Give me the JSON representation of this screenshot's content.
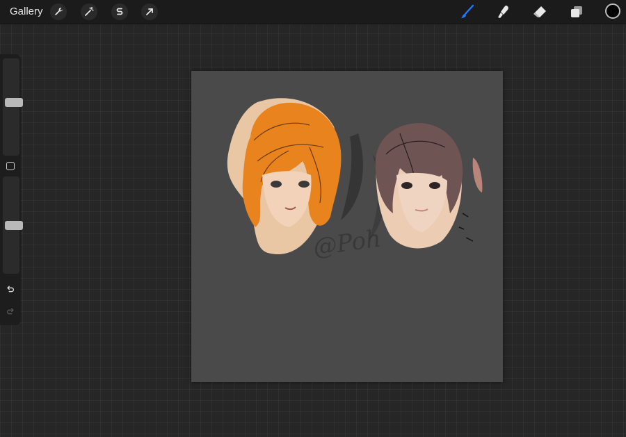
{
  "topbar": {
    "gallery_label": "Gallery",
    "tools_left": [
      {
        "name": "actions",
        "icon": "wrench-icon"
      },
      {
        "name": "adjustments",
        "icon": "magic-wand-icon"
      },
      {
        "name": "selection",
        "icon": "selection-s-icon"
      },
      {
        "name": "transform",
        "icon": "transform-arrow-icon"
      }
    ],
    "tools_right": [
      {
        "name": "brush",
        "icon": "brush-icon",
        "active": true
      },
      {
        "name": "smudge",
        "icon": "smudge-icon"
      },
      {
        "name": "eraser",
        "icon": "eraser-icon"
      },
      {
        "name": "layers",
        "icon": "layers-icon"
      }
    ],
    "current_color": "#000000",
    "active_color": "#1f7bff"
  },
  "sidebar": {
    "brush_size_level": 0.55,
    "opacity_level": 0.5
  },
  "canvas": {
    "background": "#4a4a4a",
    "watermark_text": "@Poh"
  }
}
